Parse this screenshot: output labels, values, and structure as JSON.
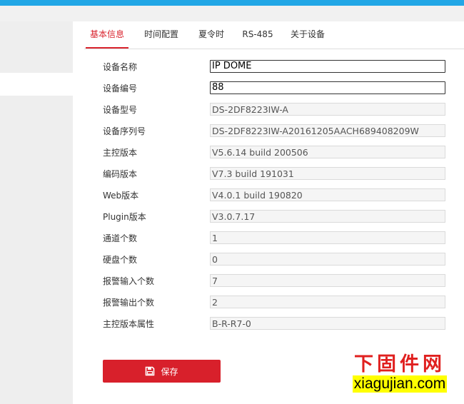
{
  "tabs": [
    {
      "label": "基本信息",
      "active": true
    },
    {
      "label": "时间配置",
      "active": false
    },
    {
      "label": "夏令时",
      "active": false
    },
    {
      "label": "RS-485",
      "active": false
    },
    {
      "label": "关于设备",
      "active": false
    }
  ],
  "fields": [
    {
      "label": "设备名称",
      "value": "IP DOME",
      "editable": true
    },
    {
      "label": "设备编号",
      "value": "88",
      "editable": true
    },
    {
      "label": "设备型号",
      "value": "DS-2DF8223IW-A",
      "editable": false
    },
    {
      "label": "设备序列号",
      "value": "DS-2DF8223IW-A20161205AACH689408209W",
      "editable": false
    },
    {
      "label": "主控版本",
      "value": "V5.6.14 build 200506",
      "editable": false
    },
    {
      "label": "编码版本",
      "value": "V7.3 build 191031",
      "editable": false
    },
    {
      "label": "Web版本",
      "value": "V4.0.1 build 190820",
      "editable": false
    },
    {
      "label": "Plugin版本",
      "value": "V3.0.7.17",
      "editable": false
    },
    {
      "label": "通道个数",
      "value": "1",
      "editable": false
    },
    {
      "label": "硬盘个数",
      "value": "0",
      "editable": false
    },
    {
      "label": "报警输入个数",
      "value": "7",
      "editable": false
    },
    {
      "label": "报警输出个数",
      "value": "2",
      "editable": false
    },
    {
      "label": "主控版本属性",
      "value": "B-R-R7-0",
      "editable": false
    }
  ],
  "save": {
    "label": "保存",
    "icon": "save-icon"
  },
  "watermark": {
    "cn": "下固件网",
    "en": "xiagujian.com"
  },
  "colors": {
    "accent": "#d9232d",
    "topbar": "#22a7e6",
    "watermark_cn": "#e0201f",
    "watermark_bg": "#ffff00"
  }
}
